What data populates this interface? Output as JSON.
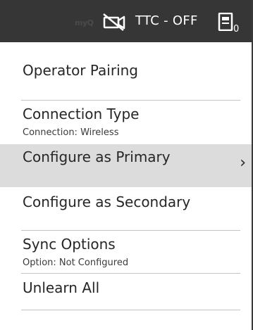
{
  "header": {
    "logo_text": "myQ",
    "camera_icon": "camera-off-icon",
    "status": "TTC - OFF",
    "remote_icon": "remote-icon",
    "remote_count": "0"
  },
  "menu": {
    "items": [
      {
        "label": "Operator Pairing",
        "sub": ""
      },
      {
        "label": "Connection Type",
        "sub": "Connection: Wireless"
      },
      {
        "label": "Configure as Primary",
        "sub": "",
        "chevron": "›"
      },
      {
        "label": "Configure as Secondary",
        "sub": ""
      },
      {
        "label": "Sync Options",
        "sub": "Option: Not Configured"
      },
      {
        "label": "Unlearn All",
        "sub": ""
      }
    ]
  },
  "colors": {
    "header_bg": "#363636",
    "selected_bg": "#dcdcdc",
    "text": "#262626",
    "divider": "#c4c4c4"
  }
}
